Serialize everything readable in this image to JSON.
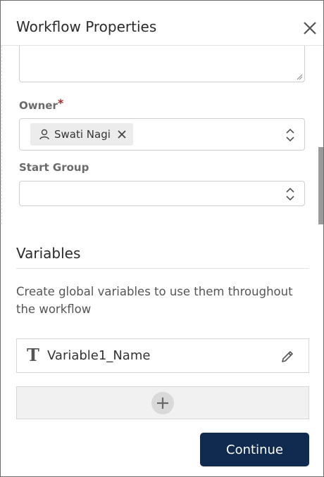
{
  "dialog": {
    "title": "Workflow Properties"
  },
  "owner": {
    "label": "Owner",
    "required_mark": "*",
    "selected_user": "Swati Nagi"
  },
  "start_group": {
    "label": "Start Group",
    "value": ""
  },
  "variables": {
    "heading": "Variables",
    "description": "Create global variables to use them throughout the workflow",
    "items": [
      {
        "type_icon": "T",
        "name": "Variable1_Name"
      }
    ]
  },
  "actions": {
    "continue_label": "Continue"
  },
  "colors": {
    "primary_button": "#102a50",
    "required": "#a52a2a"
  }
}
